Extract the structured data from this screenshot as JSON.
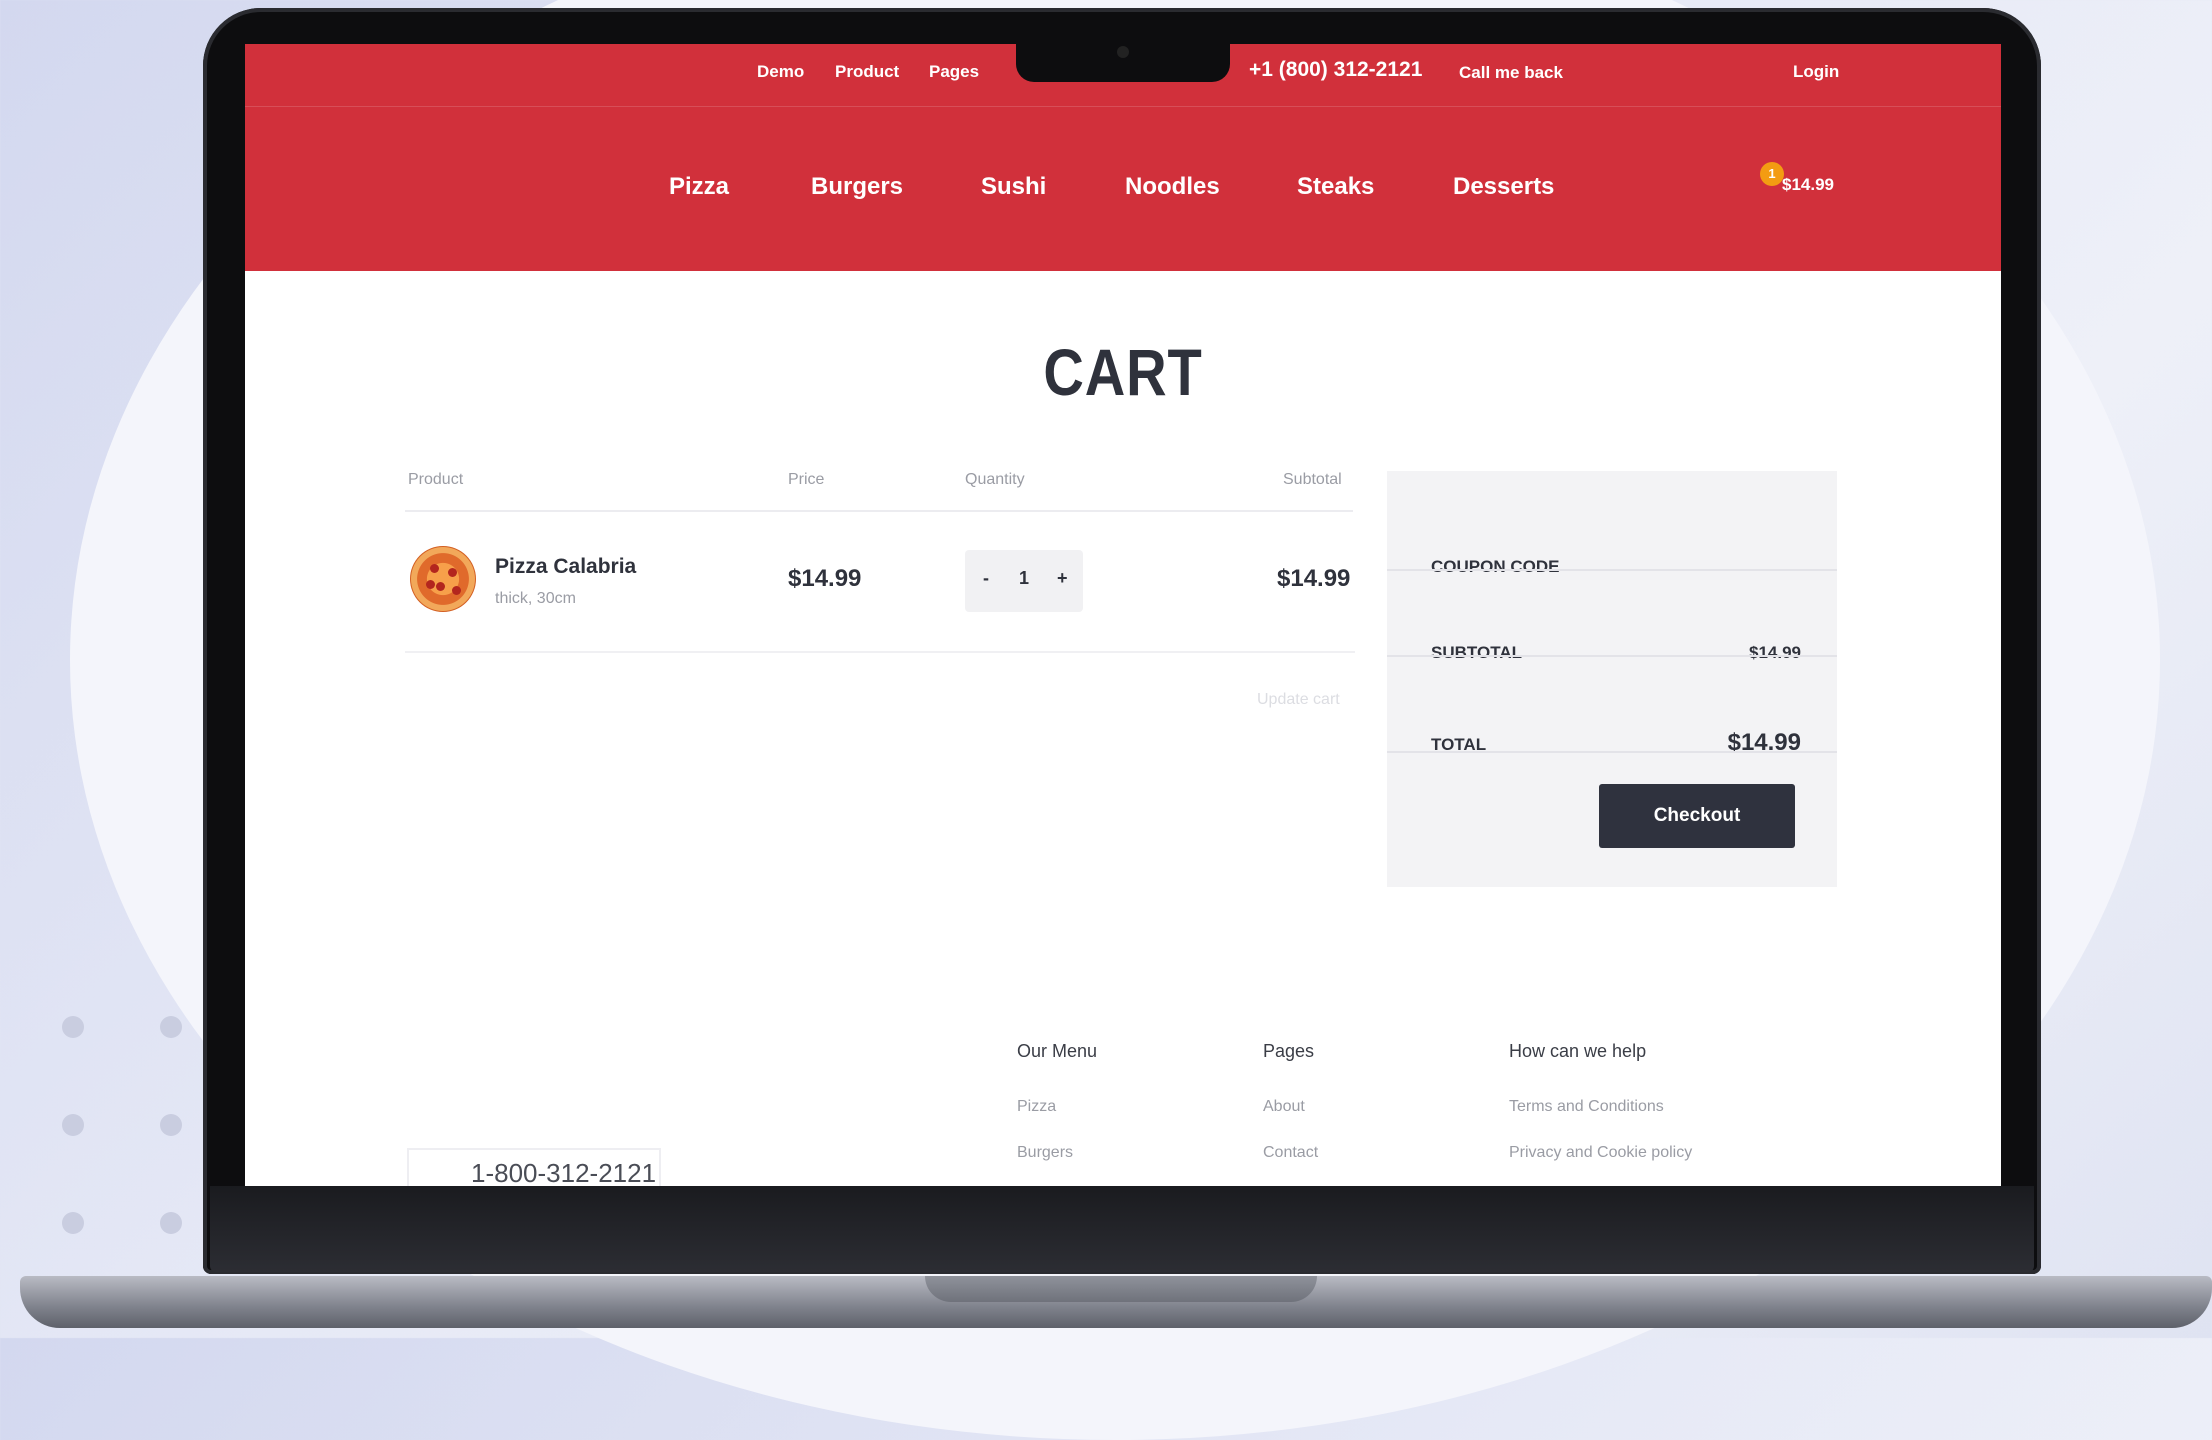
{
  "topbar": {
    "links": [
      "Demo",
      "Product",
      "Pages"
    ],
    "phone": "+1 (800) 312-2121",
    "callback": "Call me back",
    "login": "Login"
  },
  "nav": {
    "items": [
      "Pizza",
      "Burgers",
      "Sushi",
      "Noodles",
      "Steaks",
      "Desserts"
    ],
    "cart_count": "1",
    "cart_total": "$14.99"
  },
  "page": {
    "title": "CART"
  },
  "table": {
    "headers": [
      "Product",
      "Price",
      "Quantity",
      "Subtotal"
    ],
    "rows": [
      {
        "name": "Pizza Calabria",
        "variant": "thick, 30cm",
        "price": "$14.99",
        "quantity": "1",
        "subtotal": "$14.99"
      }
    ],
    "qty_minus": "-",
    "qty_plus": "+",
    "update_label": "Update cart"
  },
  "summary": {
    "coupon_label": "COUPON CODE",
    "subtotal_label": "SUBTOTAL",
    "subtotal_value": "$14.99",
    "total_label": "TOTAL",
    "total_value": "$14.99",
    "checkout_label": "Checkout"
  },
  "footer": {
    "phone": "1-800-312-2121",
    "columns": [
      {
        "title": "Our Menu",
        "links": [
          "Pizza",
          "Burgers"
        ]
      },
      {
        "title": "Pages",
        "links": [
          "About",
          "Contact"
        ]
      },
      {
        "title": "How can we help",
        "links": [
          "Terms and Conditions",
          "Privacy and Cookie policy"
        ]
      }
    ]
  },
  "colors": {
    "brand_red": "#d1303b",
    "dark": "#2f323e",
    "badge": "#f39c12"
  },
  "icons": {
    "cart": "cart-icon",
    "pizza_thumbnail": "pizza-image"
  }
}
